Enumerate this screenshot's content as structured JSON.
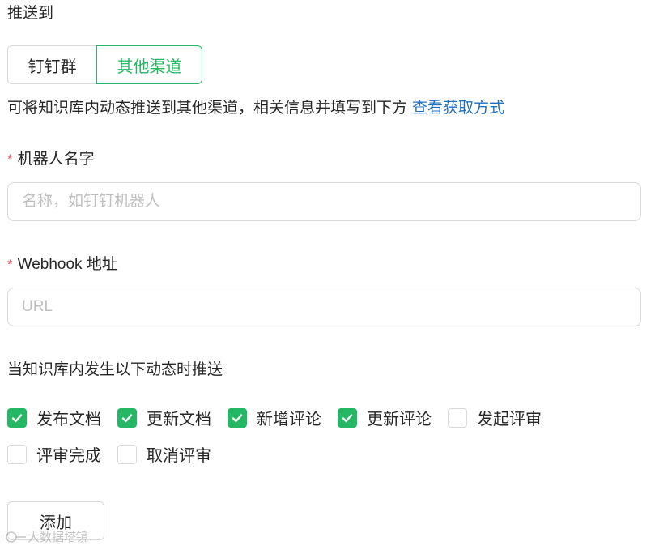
{
  "push_to": {
    "label": "推送到",
    "options": [
      "钉钉群",
      "其他渠道"
    ],
    "selected": "其他渠道"
  },
  "description": {
    "text": "可将知识库内动态推送到其他渠道，相关信息并填写到下方",
    "link": "查看获取方式"
  },
  "robot_name": {
    "required_mark": "*",
    "label": "机器人名字",
    "placeholder": "名称，如钉钉机器人",
    "value": ""
  },
  "webhook": {
    "required_mark": "*",
    "label": "Webhook 地址",
    "placeholder": "URL",
    "value": ""
  },
  "events": {
    "label": "当知识库内发生以下动态时推送",
    "items": [
      {
        "label": "发布文档",
        "checked": true
      },
      {
        "label": "更新文档",
        "checked": true
      },
      {
        "label": "新增评论",
        "checked": true
      },
      {
        "label": "更新评论",
        "checked": true
      },
      {
        "label": "发起评审",
        "checked": false
      },
      {
        "label": "评审完成",
        "checked": false
      },
      {
        "label": "取消评审",
        "checked": false
      }
    ]
  },
  "add_button": "添加",
  "watermark": "大数据塔镜",
  "colors": {
    "accent": "#25b864",
    "link": "#1f6fbf",
    "required": "#e34d59",
    "border": "#d9d9d9"
  },
  "icons": {
    "checkmark": "check-icon",
    "watermark": "watermark-logo-icon"
  }
}
